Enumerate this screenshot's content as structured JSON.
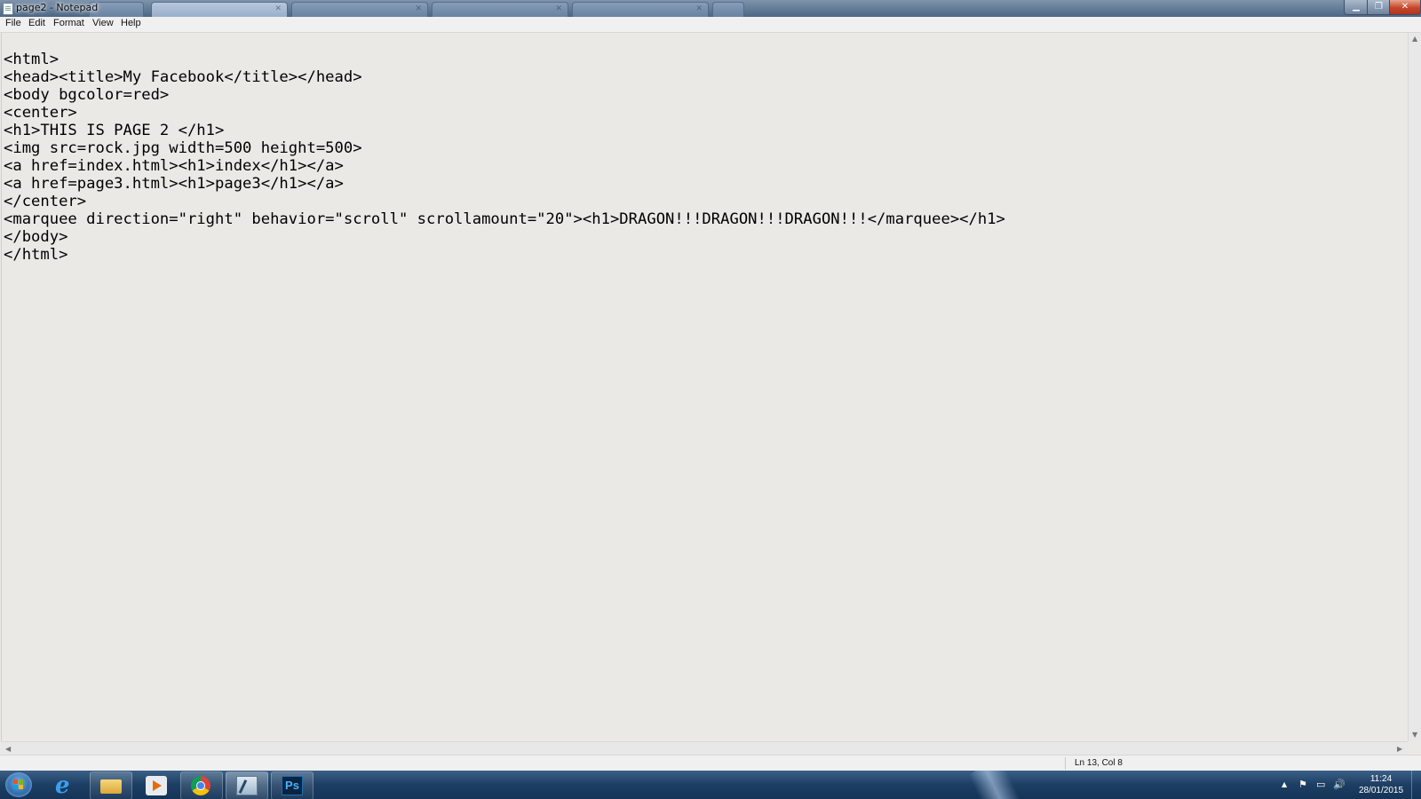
{
  "window": {
    "title": "page2 - Notepad"
  },
  "menu": [
    "File",
    "Edit",
    "Format",
    "View",
    "Help"
  ],
  "editor": {
    "lines": [
      "<html>",
      "<head><title>My Facebook</title></head>",
      "<body bgcolor=red>",
      "<center>",
      "<h1>THIS IS PAGE 2 </h1>",
      "<img src=rock.jpg width=500 height=500>",
      "<a href=index.html><h1>index</h1></a>",
      "<a href=page3.html><h1>page3</h1></a>",
      "</center>",
      "<marquee direction=\"right\" behavior=\"scroll\" scrollamount=\"20\"><h1>DRAGON!!!DRAGON!!!DRAGON!!!</marquee></h1>",
      "</body>",
      "</html>"
    ]
  },
  "status": {
    "cursor_position": "Ln 13, Col 8"
  },
  "taskbar": {
    "apps": [
      {
        "name": "internet-explorer",
        "icon": "ie-icon"
      },
      {
        "name": "windows-explorer",
        "icon": "folder-icon"
      },
      {
        "name": "media-player",
        "icon": "media-player-icon"
      },
      {
        "name": "chrome",
        "icon": "chrome-icon"
      },
      {
        "name": "notepad",
        "icon": "notepad-icon"
      },
      {
        "name": "photoshop",
        "icon": "photoshop-icon",
        "label": "Ps"
      }
    ],
    "clock": {
      "time": "11:24",
      "date": "28/01/2015"
    }
  },
  "colors": {
    "editor_background": "#ebe9e5",
    "taskbar": "#1d3e63",
    "close_button": "#c4462c"
  }
}
